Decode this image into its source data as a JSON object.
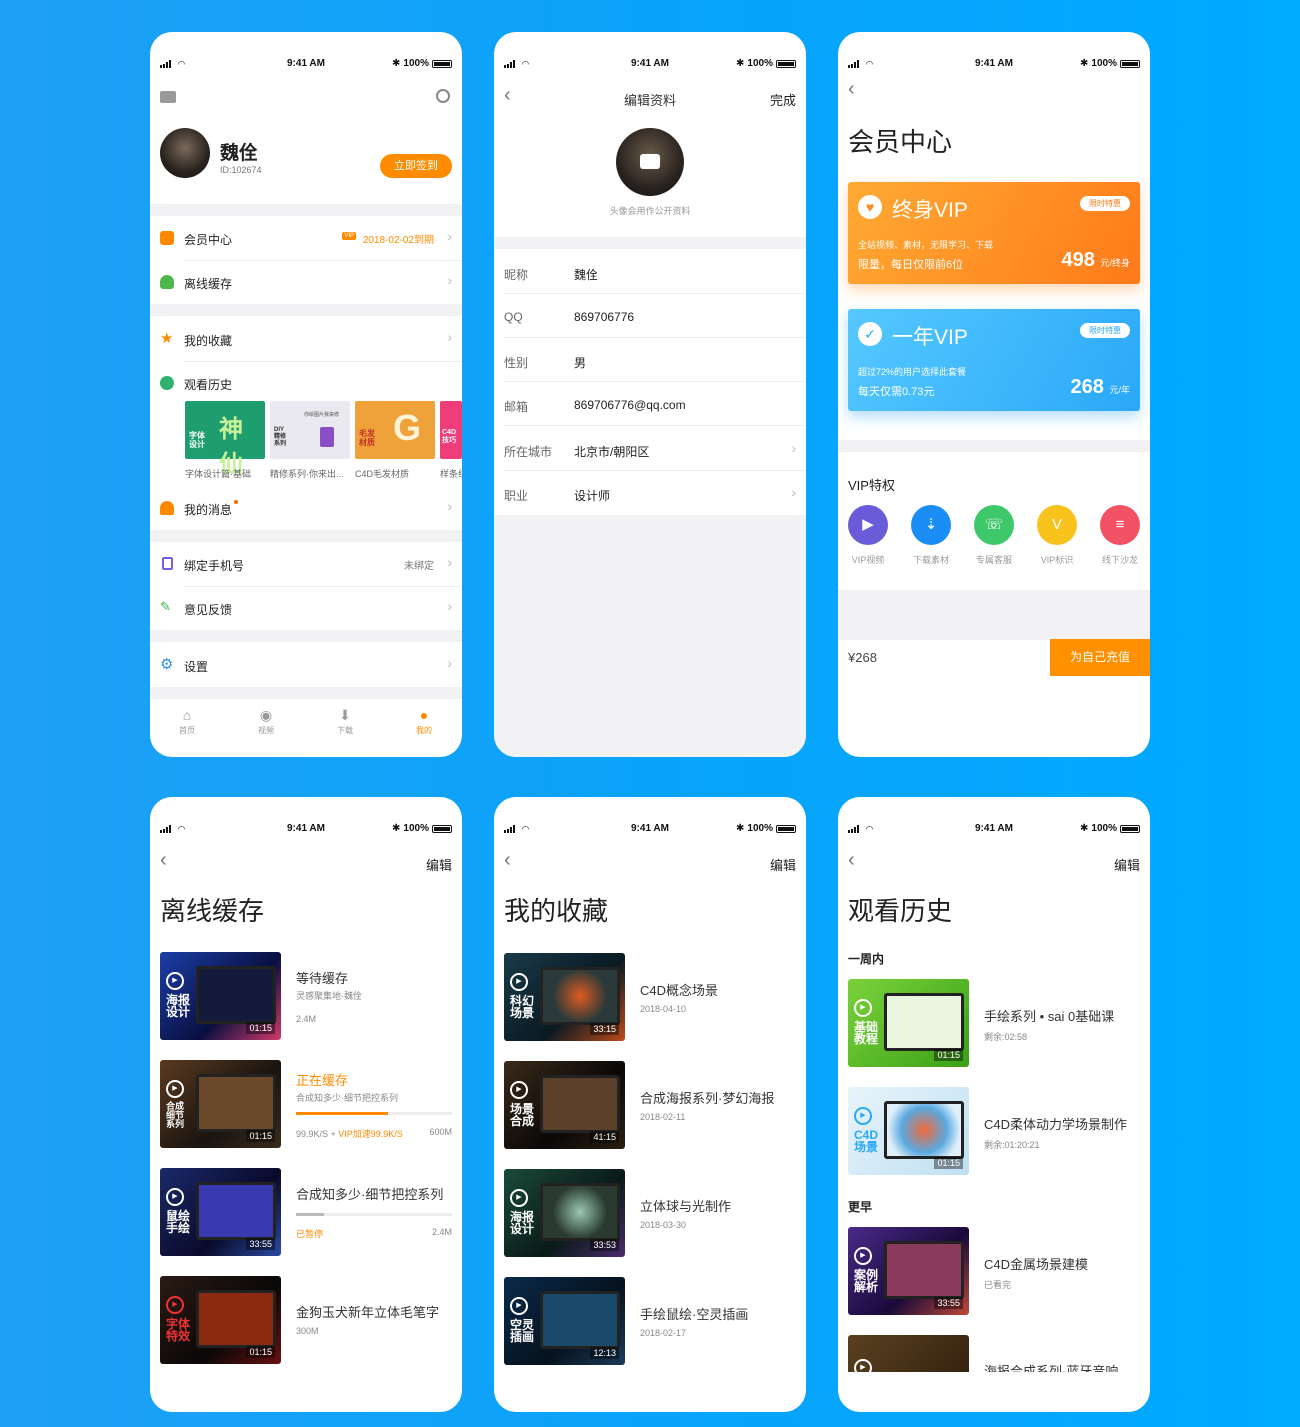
{
  "status": {
    "time": "9:41 AM",
    "battery": "100%"
  },
  "profile": {
    "name": "魏佺",
    "id": "ID:102674",
    "checkin": "立即签到",
    "rows": {
      "vip": "会员中心",
      "vip_date": "2018-02-02到期",
      "vip_tag": "VIP",
      "offline": "离线缓存",
      "fav": "我的收藏",
      "history": "观看历史",
      "msg": "我的消息",
      "phone": "绑定手机号",
      "phone_status": "未绑定",
      "feedback": "意见反馈",
      "settings": "设置"
    },
    "history_thumbs": [
      {
        "caption": "字体设计篇·基础",
        "tag": "字体设计",
        "art": "神仙"
      },
      {
        "caption": "精修系列·你来出...",
        "tag": "DIY精修系列",
        "art": "你绘图片我来修"
      },
      {
        "caption": "C4D毛发材质",
        "tag": "毛发材质",
        "art": "G"
      },
      {
        "caption": "样条线",
        "tag": "C4D技巧",
        "art": ""
      }
    ],
    "tabs": [
      "首页",
      "视频",
      "下载",
      "我的"
    ]
  },
  "edit": {
    "title": "编辑资料",
    "done": "完成",
    "avatar_hint": "头像会用作公开资料",
    "fields": [
      {
        "k": "昵称",
        "v": "魏佺"
      },
      {
        "k": "QQ",
        "v": "869706776"
      },
      {
        "k": "性别",
        "v": "男"
      },
      {
        "k": "邮箱",
        "v": "869706776@qq.com"
      },
      {
        "k": "所在城市",
        "v": "北京市/朝阳区"
      },
      {
        "k": "职业",
        "v": "设计师"
      }
    ]
  },
  "member": {
    "title": "会员中心",
    "card1": {
      "title": "终身VIP",
      "badge": "限时特惠",
      "d1": "全站视频、素材，无限学习、下载",
      "d2": "限量，每日仅限前6位",
      "price": "498",
      "unit": "元/终身"
    },
    "card2": {
      "title": "一年VIP",
      "badge": "限时特惠",
      "d1": "超过72%的用户选择此套餐",
      "d2": "每天仅需0.73元",
      "price": "268",
      "unit": "元/年"
    },
    "priv_title": "VIP特权",
    "privs": [
      {
        "label": "VIP视频",
        "color": "#6a5bd8",
        "icon": "▶"
      },
      {
        "label": "下载素材",
        "color": "#1a8ef5",
        "icon": "⇣"
      },
      {
        "label": "专属客服",
        "color": "#3ec86a",
        "icon": "☏"
      },
      {
        "label": "VIP标识",
        "color": "#f7c31c",
        "icon": "V"
      },
      {
        "label": "线下沙龙",
        "color": "#f25264",
        "icon": "≡"
      }
    ],
    "total": "¥268",
    "pay": "为自己充值"
  },
  "offline": {
    "title": "离线缓存",
    "edit": "编辑",
    "items": [
      {
        "tag": "海报设计",
        "dur": "01:15",
        "title": "等待缓存",
        "sub": "灵感聚集地·魏佺",
        "size": "2.4M"
      },
      {
        "tag": "合成细节系列",
        "dur": "01:15",
        "title": "正在缓存",
        "sub": "合成知多少·细节把控系列",
        "speed": "99.9K/S + ",
        "vipspeed": "VIP加速99.9K/S",
        "size": "600M"
      },
      {
        "tag": "鼠绘手绘",
        "dur": "33:55",
        "title": "合成知多少·细节把控系列",
        "status": "已暂停",
        "size": "2.4M"
      },
      {
        "tag": "字体特效",
        "dur": "01:15",
        "title": "金狗玉犬新年立体毛笔字",
        "size": "300M"
      }
    ]
  },
  "favs": {
    "title": "我的收藏",
    "edit": "编辑",
    "items": [
      {
        "tag": "科幻场景",
        "dur": "33:15",
        "title": "C4D概念场景",
        "date": "2018-04-10"
      },
      {
        "tag": "场景合成",
        "dur": "41:15",
        "title": "合成海报系列·梦幻海报",
        "date": "2018-02-11"
      },
      {
        "tag": "海报设计",
        "dur": "33:53",
        "title": "立体球与光制作",
        "date": "2018-03-30"
      },
      {
        "tag": "空灵插画",
        "dur": "12:13",
        "title": "手绘鼠绘·空灵插画",
        "date": "2018-02-17"
      }
    ]
  },
  "history": {
    "title": "观看历史",
    "edit": "编辑",
    "week": "一周内",
    "earlier": "更早",
    "items": [
      {
        "tag": "基础教程",
        "dur": "01:15",
        "title": "手绘系列 • sai 0基础课",
        "sub": "剩余:02:58"
      },
      {
        "tag": "C4D场景",
        "dur": "01:15",
        "title": "C4D柔体动力学场景制作",
        "sub": "剩余:01:20:21"
      },
      {
        "tag": "案例解析",
        "dur": "33:55",
        "title": "C4D金属场景建模",
        "sub": "已看完"
      },
      {
        "tag": "",
        "dur": "",
        "title": "海报合成系列·蓝牙音响",
        "sub": ""
      }
    ]
  }
}
